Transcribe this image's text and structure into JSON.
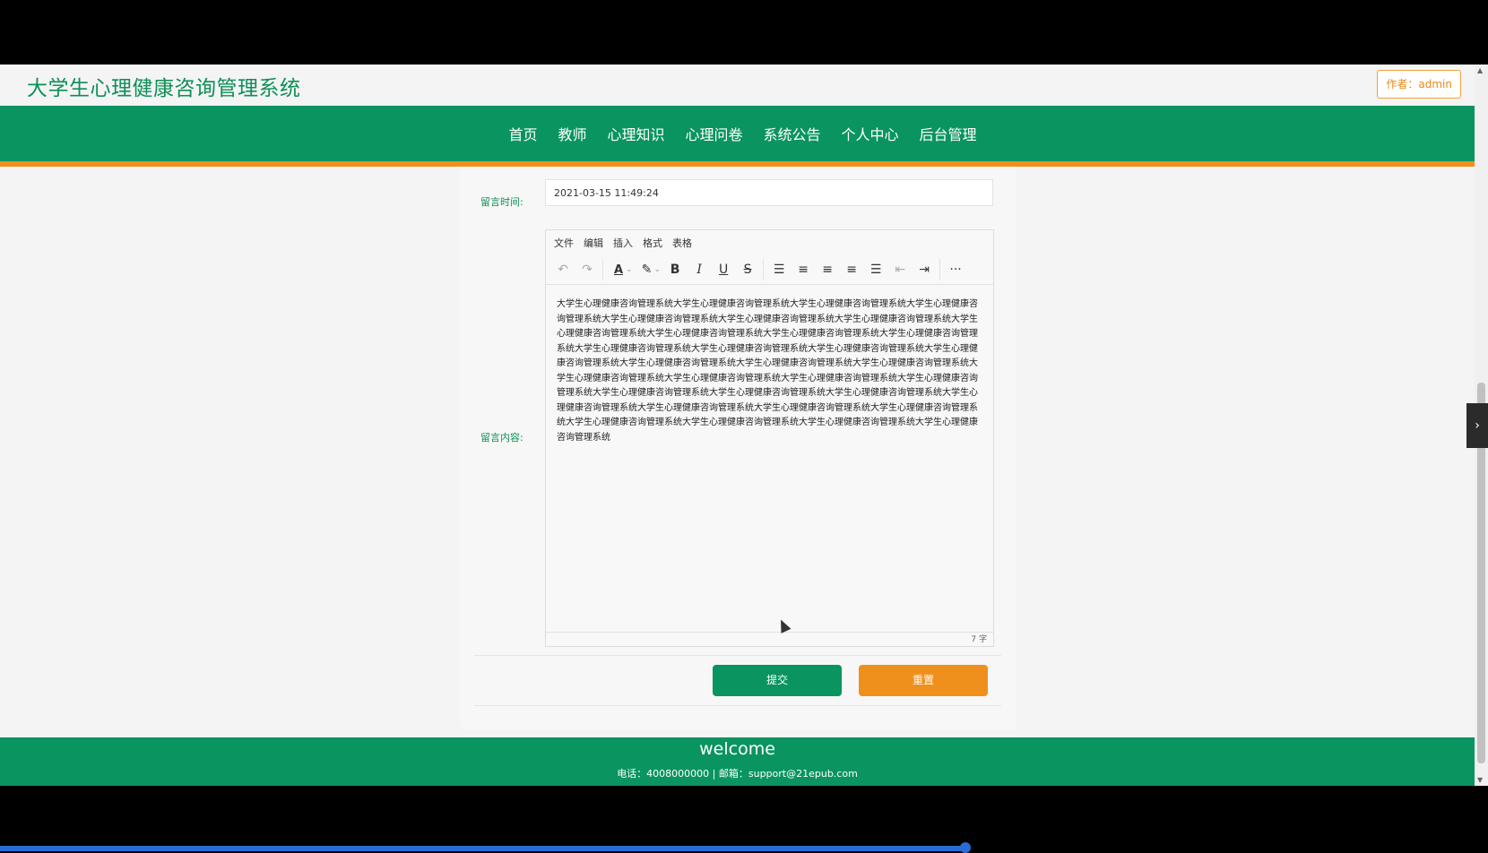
{
  "header": {
    "site_title": "大学生心理健康咨询管理系统",
    "author_badge": "作者：admin"
  },
  "nav": {
    "items": [
      "首页",
      "教师",
      "心理知识",
      "心理问卷",
      "系统公告",
      "个人中心",
      "后台管理"
    ]
  },
  "form": {
    "time_label": "留言时间:",
    "time_value": "2021-03-15 11:49:24",
    "content_label": "留言内容:",
    "editor": {
      "menus": [
        "文件",
        "编辑",
        "插入",
        "格式",
        "表格"
      ],
      "toolbar_icons": [
        "undo-icon",
        "redo-icon",
        "font-color-icon",
        "highlight-icon",
        "bold-icon",
        "italic-icon",
        "underline-icon",
        "strikethrough-icon",
        "bullet-list-icon",
        "align-left-icon",
        "align-center-icon",
        "align-right-icon",
        "justify-icon",
        "outdent-icon",
        "indent-icon",
        "more-icon"
      ],
      "content": "大学生心理健康咨询管理系统大学生心理健康咨询管理系统大学生心理健康咨询管理系统大学生心理健康咨询管理系统大学生心理健康咨询管理系统大学生心理健康咨询管理系统大学生心理健康咨询管理系统大学生心理健康咨询管理系统大学生心理健康咨询管理系统大学生心理健康咨询管理系统大学生心理健康咨询管理系统大学生心理健康咨询管理系统大学生心理健康咨询管理系统大学生心理健康咨询管理系统大学生心理健康咨询管理系统大学生心理健康咨询管理系统大学生心理健康咨询管理系统大学生心理健康咨询管理系统大学生心理健康咨询管理系统大学生心理健康咨询管理系统大学生心理健康咨询管理系统大学生心理健康咨询管理系统大学生心理健康咨询管理系统大学生心理健康咨询管理系统大学生心理健康咨询管理系统大学生心理健康咨询管理系统大学生心理健康咨询管理系统大学生心理健康咨询管理系统大学生心理健康咨询管理系统大学生心理健康咨询管理系统大学生心理健康咨询管理系统大学生心理健康咨询管理系统大学生心理健康咨询管理系统",
      "word_count": "7 字"
    },
    "submit_label": "提交",
    "reset_label": "重置"
  },
  "footer": {
    "welcome": "welcome",
    "contact": "电话：4008000000 | 邮箱：support@21epub.com"
  },
  "colors": {
    "primary_green": "#0a9460",
    "accent_orange": "#f0901c",
    "title_green": "#0d8f56"
  }
}
